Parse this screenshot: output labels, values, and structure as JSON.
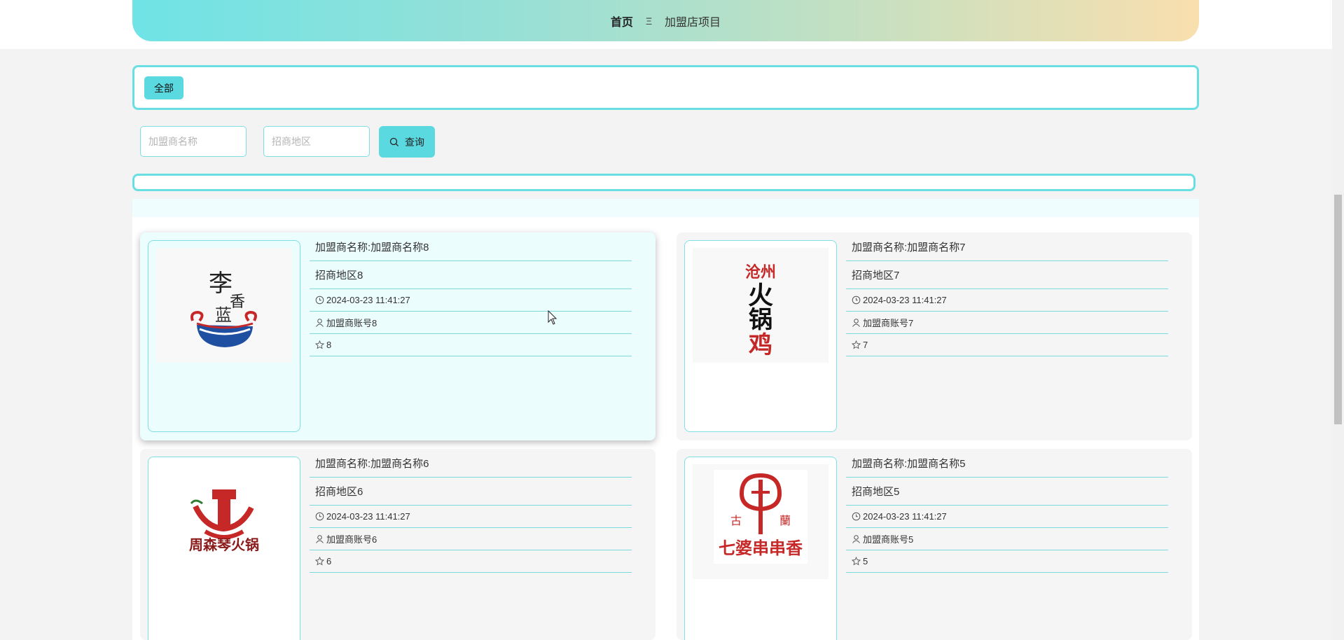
{
  "nav": {
    "home": "首页",
    "separator": "Ξ",
    "current": "加盟店项目"
  },
  "filter": {
    "chip_label": "全部"
  },
  "search": {
    "name_placeholder": "加盟商名称",
    "region_placeholder": "招商地区",
    "button_label": "查询"
  },
  "cards": [
    {
      "title": "加盟商名称:加盟商名称8",
      "region": "招商地区8",
      "time": "2024-03-23 11:41:27",
      "account": "加盟商账号8",
      "stars": "8",
      "logo": "李香蓝"
    },
    {
      "title": "加盟商名称:加盟商名称7",
      "region": "招商地区7",
      "time": "2024-03-23 11:41:27",
      "account": "加盟商账号7",
      "stars": "7",
      "logo": "沧州火锅鸡"
    },
    {
      "title": "加盟商名称:加盟商名称6",
      "region": "招商地区6",
      "time": "2024-03-23 11:41:27",
      "account": "加盟商账号6",
      "stars": "6",
      "logo": "周森琴火锅"
    },
    {
      "title": "加盟商名称:加盟商名称5",
      "region": "招商地区5",
      "time": "2024-03-23 11:41:27",
      "account": "加盟商账号5",
      "stars": "5",
      "logo": "七婆串串香"
    }
  ],
  "colors": {
    "accent": "#5bd9e0",
    "border": "#6adfe3",
    "nav_gradient_start": "#6fe3e6",
    "nav_gradient_end": "#f9dfae"
  },
  "icons": {
    "time": "clock-icon",
    "account": "user-icon",
    "stars": "star-icon",
    "search": "search-icon"
  }
}
